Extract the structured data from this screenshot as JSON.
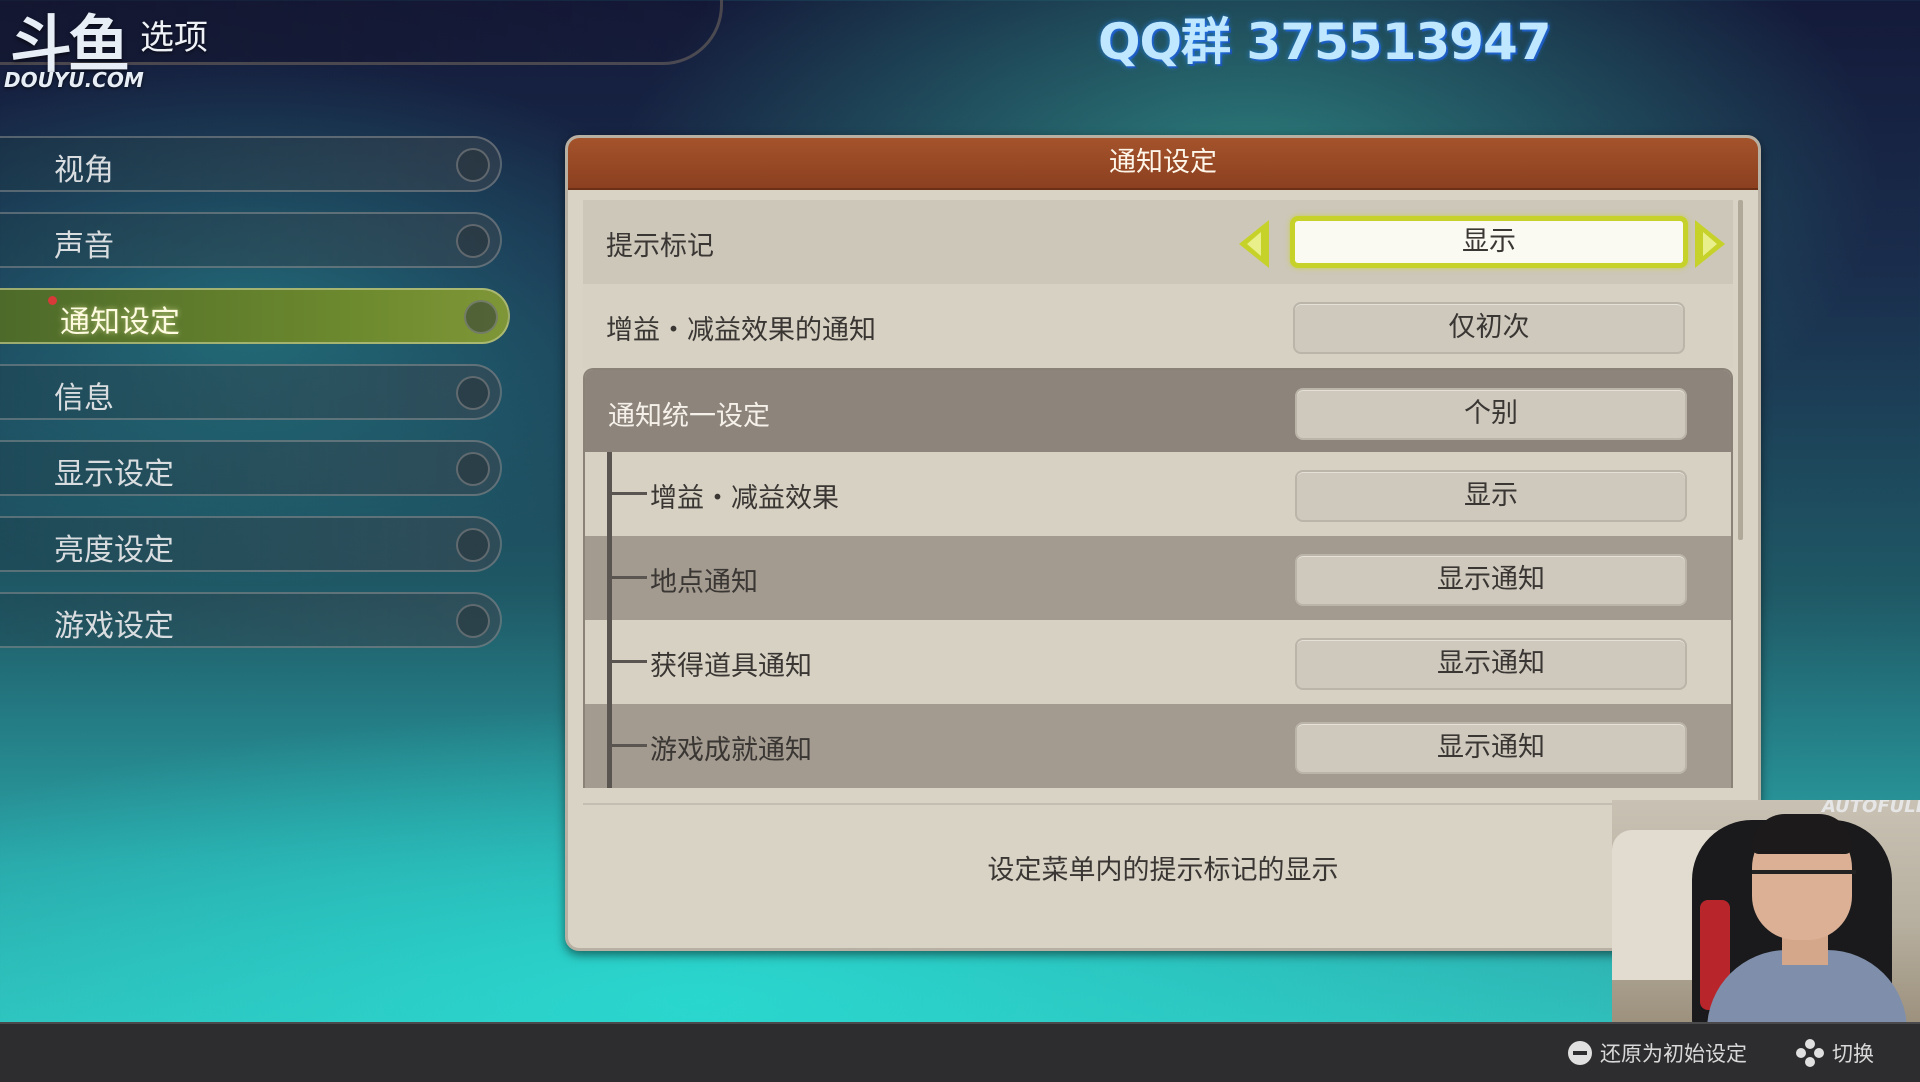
{
  "watermark": {
    "logo_text": "斗鱼",
    "logo_url": "DOUYU.COM"
  },
  "header": {
    "title": "选项"
  },
  "overlay": {
    "qq_text": "QQ群 375513947"
  },
  "sidebar": {
    "items": [
      {
        "label": "视角"
      },
      {
        "label": "声音"
      },
      {
        "label": "通知设定",
        "active": true
      },
      {
        "label": "信息"
      },
      {
        "label": "显示设定"
      },
      {
        "label": "亮度设定"
      },
      {
        "label": "游戏设定"
      }
    ]
  },
  "panel": {
    "title": "通知设定",
    "rows": [
      {
        "label": "提示标记",
        "value": "显示",
        "selected": true
      },
      {
        "label": "增益・减益效果的通知",
        "value": "仅初次"
      }
    ],
    "group": {
      "label": "通知统一设定",
      "value": "个别",
      "subs": [
        {
          "label": "增益・减益效果",
          "value": "显示"
        },
        {
          "label": "地点通知",
          "value": "显示通知"
        },
        {
          "label": "获得道具通知",
          "value": "显示通知"
        },
        {
          "label": "游戏成就通知",
          "value": "显示通知"
        }
      ]
    },
    "description": "设定菜单内的提示标记的显示"
  },
  "webcam": {
    "brand_text": "AUTOFULL"
  },
  "bottom_bar": {
    "reset_label": "还原为初始设定",
    "switch_label": "切换"
  },
  "colors": {
    "panel_header": "#a4532b",
    "active_menu": "#6d8a2e",
    "selection_highlight": "#c6d22a"
  }
}
